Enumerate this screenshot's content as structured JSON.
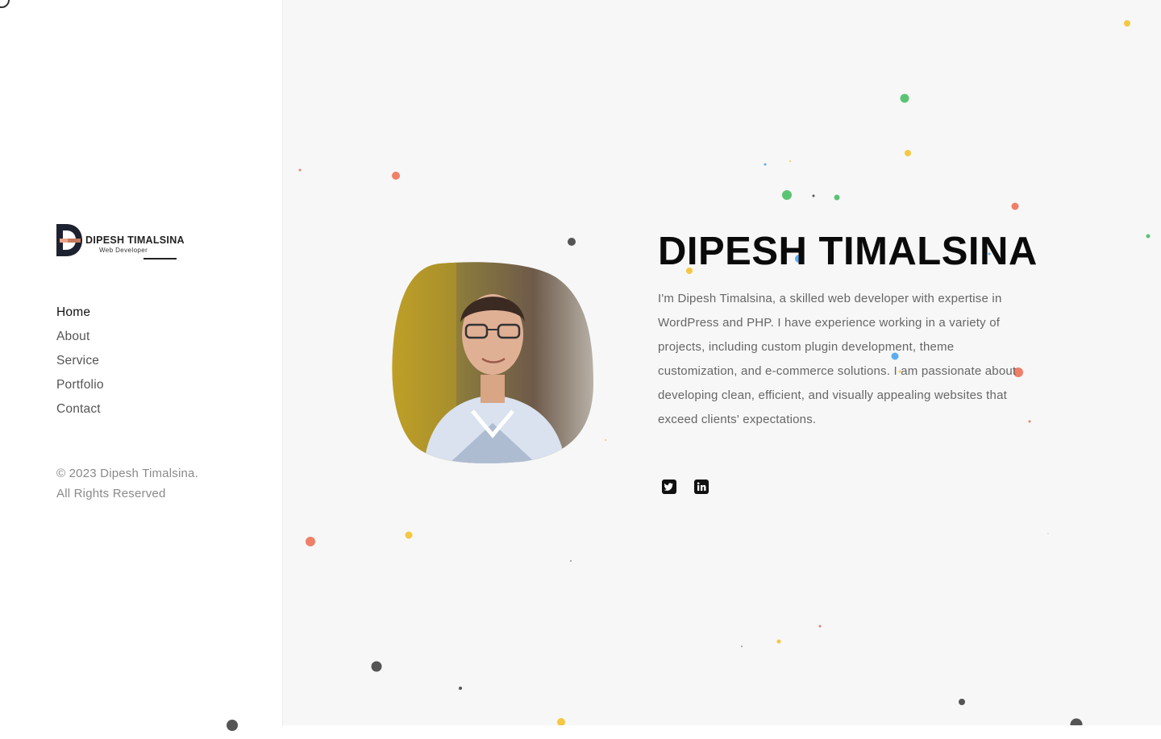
{
  "brand": {
    "name": "DIPESH TIMALSINA",
    "tagline": "Web Developer",
    "logo_icon": "d-letter-logo-icon"
  },
  "nav": {
    "items": [
      {
        "label": "Home",
        "active": true
      },
      {
        "label": "About",
        "active": false
      },
      {
        "label": "Service",
        "active": false
      },
      {
        "label": "Portfolio",
        "active": false
      },
      {
        "label": "Contact",
        "active": false
      }
    ]
  },
  "footer": {
    "line1": "© 2023 Dipesh Timalsina.",
    "line2": "All Rights Reserved"
  },
  "hero": {
    "title": "DIPESH TIMALSINA",
    "bio": "I'm Dipesh Timalsina, a skilled web developer with expertise in WordPress and PHP. I have experience working in a variety of projects, including custom plugin development, theme customization, and e-commerce solutions. I am passionate about developing clean, efficient, and visually appealing websites that exceed clients' expectations.",
    "portrait_icon": "profile-photo"
  },
  "social": [
    {
      "name": "twitter-icon"
    },
    {
      "name": "linkedin-icon"
    }
  ],
  "colors": {
    "accent_dark": "#111111",
    "dot_green": "#5bc474",
    "dot_yellow": "#f5c842",
    "dot_coral": "#f07f68",
    "dot_blue": "#5aaef0",
    "dot_gray": "#555555"
  }
}
